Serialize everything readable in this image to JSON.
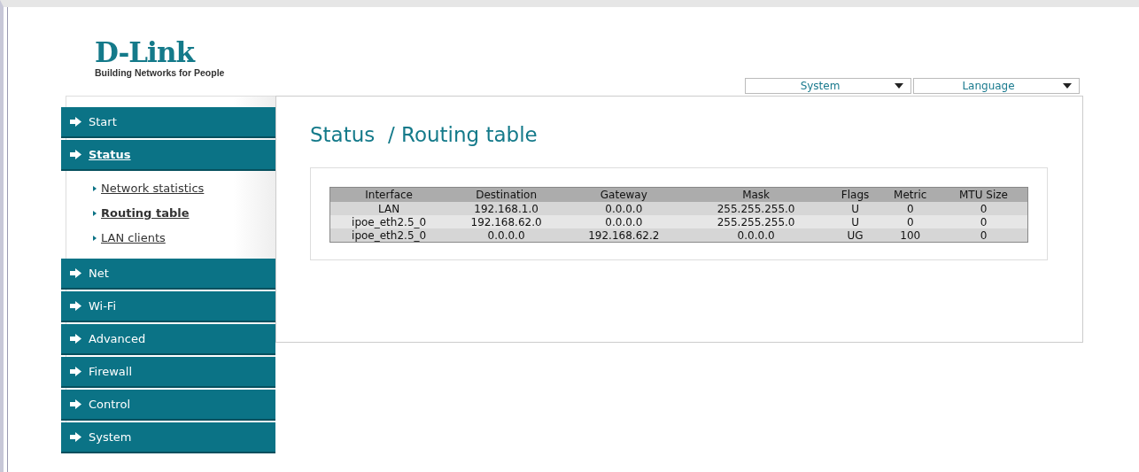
{
  "logo": {
    "name": "D-Link",
    "tagline": "Building Networks for People"
  },
  "top_menus": [
    {
      "label": "System"
    },
    {
      "label": "Language"
    }
  ],
  "sidebar": {
    "items": [
      {
        "label": "Start",
        "selected": false
      },
      {
        "label": "Status",
        "selected": true,
        "expanded": true,
        "children": [
          {
            "label": "Network statistics",
            "selected": false
          },
          {
            "label": "Routing table",
            "selected": true
          },
          {
            "label": "LAN clients",
            "selected": false
          }
        ]
      },
      {
        "label": "Net",
        "selected": false
      },
      {
        "label": "Wi-Fi",
        "selected": false
      },
      {
        "label": "Advanced",
        "selected": false
      },
      {
        "label": "Firewall",
        "selected": false
      },
      {
        "label": "Control",
        "selected": false
      },
      {
        "label": "System",
        "selected": false
      }
    ]
  },
  "page_title": "Status  / Routing table",
  "table": {
    "columns": [
      "Interface",
      "Destination",
      "Gateway",
      "Mask",
      "Flags",
      "Metric",
      "MTU Size"
    ],
    "rows": [
      [
        "LAN",
        "192.168.1.0",
        "0.0.0.0",
        "255.255.255.0",
        "U",
        "0",
        "0"
      ],
      [
        "ipoe_eth2.5_0",
        "192.168.62.0",
        "0.0.0.0",
        "255.255.255.0",
        "U",
        "0",
        "0"
      ],
      [
        "ipoe_eth2.5_0",
        "0.0.0.0",
        "192.168.62.2",
        "0.0.0.0",
        "UG",
        "100",
        "0"
      ]
    ]
  }
}
